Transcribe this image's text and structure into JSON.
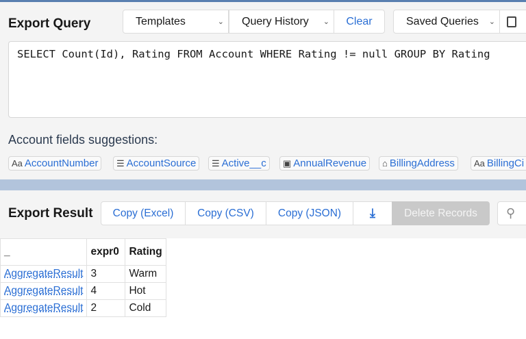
{
  "query_section": {
    "title": "Export Query",
    "templates": "Templates",
    "history": "Query History",
    "clear": "Clear",
    "saved": "Saved Queries",
    "query": "SELECT Count(Id), Rating FROM Account WHERE Rating != null GROUP BY Rating"
  },
  "suggestions": {
    "title": "Account fields suggestions:",
    "fields": [
      {
        "icon": "Aa",
        "label": "AccountNumber"
      },
      {
        "icon": "☰",
        "label": "AccountSource"
      },
      {
        "icon": "☰",
        "label": "Active__c"
      },
      {
        "icon": "▣",
        "label": "AnnualRevenue"
      },
      {
        "icon": "⌂",
        "label": "BillingAddress"
      },
      {
        "icon": "Aa",
        "label": "BillingCi"
      }
    ]
  },
  "result_section": {
    "title": "Export Result",
    "copy_excel": "Copy (Excel)",
    "copy_csv": "Copy (CSV)",
    "copy_json": "Copy (JSON)",
    "delete": "Delete Records"
  },
  "table": {
    "headers": [
      "_",
      "expr0",
      "Rating"
    ],
    "rows": [
      [
        "AggregateResult",
        "3",
        "Warm"
      ],
      [
        "AggregateResult",
        "4",
        "Hot"
      ],
      [
        "AggregateResult",
        "2",
        "Cold"
      ]
    ]
  }
}
